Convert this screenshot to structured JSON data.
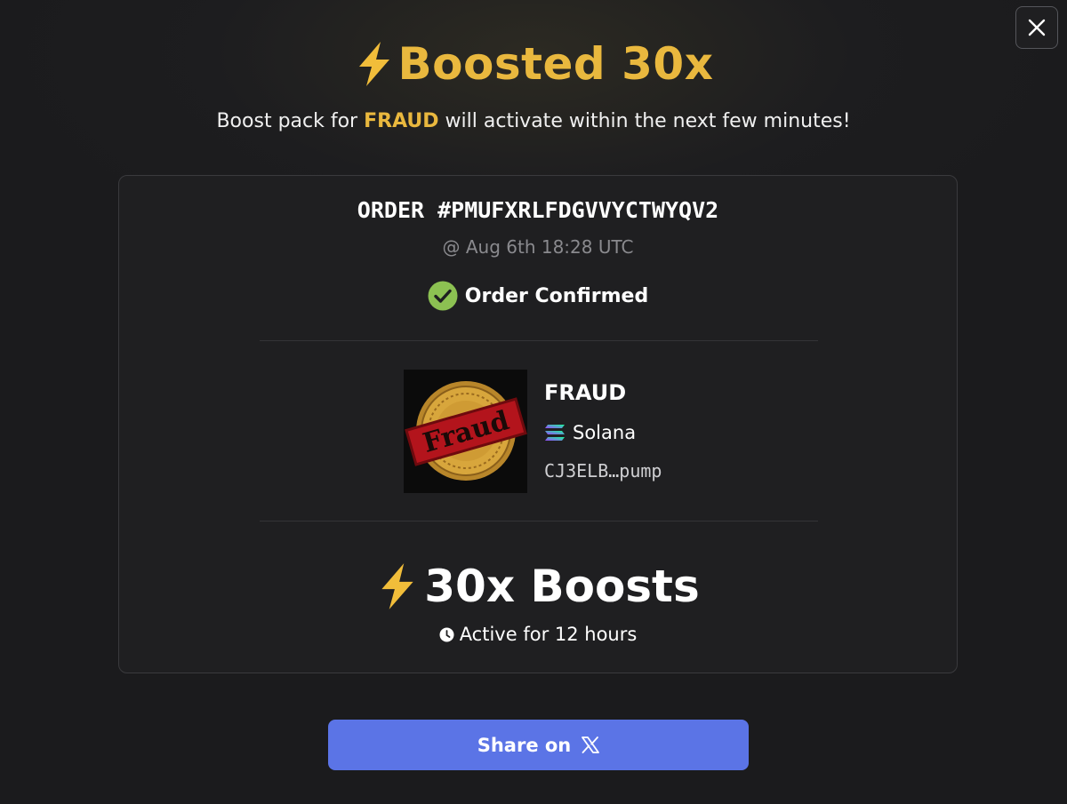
{
  "modal": {
    "close_icon": "close-icon",
    "title": "Boosted 30x",
    "title_icon": "lightning-icon",
    "subtitle_prefix": "Boost pack for",
    "subtitle_token": "FRAUD",
    "subtitle_suffix": "will activate within the next few minutes!"
  },
  "order": {
    "id_label": "ORDER #PMUFXRLFDGVVYCTWYQV2",
    "timestamp": "@ Aug 6th 18:28 UTC",
    "status": "Order Confirmed",
    "status_icon": "check-circle-icon"
  },
  "token": {
    "name": "FRAUD",
    "image_text": "Fraud",
    "chain": "Solana",
    "chain_icon": "solana-icon",
    "address": "CJ3ELB…pump"
  },
  "boost": {
    "label": "30x Boosts",
    "duration": "Active for 12 hours",
    "duration_icon": "clock-icon"
  },
  "share": {
    "label": "Share on",
    "icon": "x-logo-icon"
  },
  "colors": {
    "accent": "#e9b83e",
    "button": "#5b74e6",
    "success": "#8cc152",
    "background": "#1c1c1e"
  }
}
